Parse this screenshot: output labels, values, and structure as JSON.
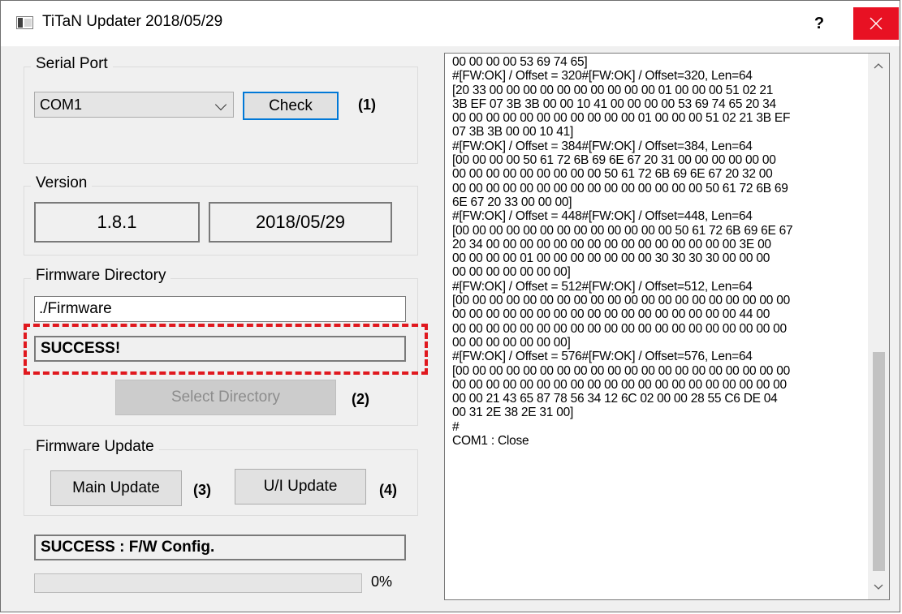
{
  "window": {
    "title": "TiTaN Updater 2018/05/29",
    "help_label": "?"
  },
  "serial_port": {
    "group_label": "Serial Port",
    "selected_port": "COM1",
    "check_label": "Check",
    "step_label": "(1)"
  },
  "version": {
    "group_label": "Version",
    "version_number": "1.8.1",
    "version_date": "2018/05/29"
  },
  "firmware_directory": {
    "group_label": "Firmware Directory",
    "path_value": "./Firmware",
    "status_text": "SUCCESS!",
    "select_label": "Select Directory",
    "step_label": "(2)"
  },
  "firmware_update": {
    "group_label": "Firmware Update",
    "main_update_label": "Main Update",
    "main_step_label": "(3)",
    "ui_update_label": "U/I Update",
    "ui_step_label": "(4)"
  },
  "status": {
    "text": "SUCCESS : F/W Config."
  },
  "progress": {
    "value": 0,
    "label": "0%"
  },
  "log": {
    "text": "00 00 00 00 53 69 74 65]\n#[FW:OK] / Offset = 320#[FW:OK] / Offset=320, Len=64\n[20 33 00 00 00 00 00 00 00 00 00 00 01 00 00 00 51 02 21\n3B EF 07 3B 3B 00 00 10 41 00 00 00 00 53 69 74 65 20 34\n00 00 00 00 00 00 00 00 00 00 00 01 00 00 00 51 02 21 3B EF\n07 3B 3B 00 00 10 41]\n#[FW:OK] / Offset = 384#[FW:OK] / Offset=384, Len=64\n[00 00 00 00 50 61 72 6B 69 6E 67 20 31 00 00 00 00 00 00\n00 00 00 00 00 00 00 00 00 50 61 72 6B 69 6E 67 20 32 00\n00 00 00 00 00 00 00 00 00 00 00 00 00 00 00 50 61 72 6B 69\n6E 67 20 33 00 00 00]\n#[FW:OK] / Offset = 448#[FW:OK] / Offset=448, Len=64\n[00 00 00 00 00 00 00 00 00 00 00 00 00 50 61 72 6B 69 6E 67\n20 34 00 00 00 00 00 00 00 00 00 00 00 00 00 00 00 3E 00\n00 00 00 00 01 00 00 00 00 00 00 00 30 30 30 30 00 00 00\n00 00 00 00 00 00 00]\n#[FW:OK] / Offset = 512#[FW:OK] / Offset=512, Len=64\n[00 00 00 00 00 00 00 00 00 00 00 00 00 00 00 00 00 00 00 00\n00 00 00 00 00 00 00 00 00 00 00 00 00 00 00 00 00 44 00\n00 00 00 00 00 00 00 00 00 00 00 00 00 00 00 00 00 00 00 00\n00 00 00 00 00 00 00]\n#[FW:OK] / Offset = 576#[FW:OK] / Offset=576, Len=64\n[00 00 00 00 00 00 00 00 00 00 00 00 00 00 00 00 00 00 00 00\n00 00 00 00 00 00 00 00 00 00 00 00 00 00 00 00 00 00 00 00\n00 00 21 43 65 87 78 56 34 12 6C 02 00 00 28 55 C6 DE 04\n00 31 2E 38 2E 31 00]\n#\nCOM1 : Close"
  },
  "colors": {
    "accent_focus": "#0078d7",
    "close_button": "#e81123",
    "highlight_dash": "#e0181e"
  },
  "icons": {
    "app": "app-icon",
    "close": "close-icon",
    "dropdown": "chevron-down-icon",
    "scroll_up": "chevron-up-icon",
    "scroll_down": "chevron-down-icon"
  }
}
